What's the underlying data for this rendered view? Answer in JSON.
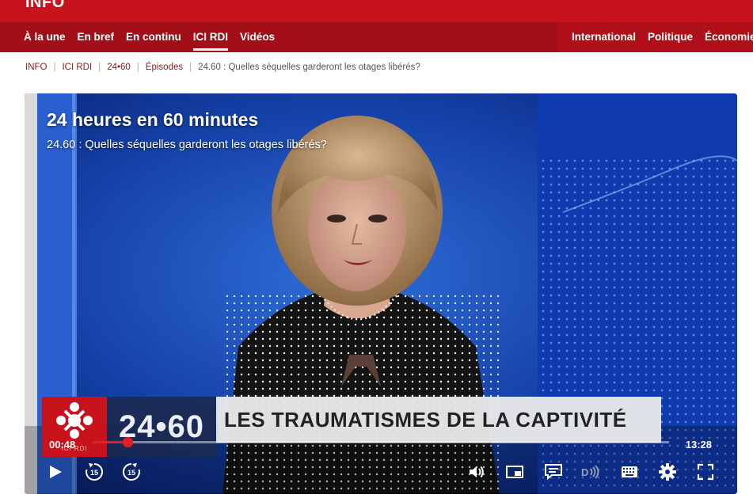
{
  "header": {
    "brand": "INFO",
    "nav_left": [
      "À la une",
      "En bref",
      "En continu",
      "ICI RDI",
      "Vidéos"
    ],
    "active_index": 3,
    "nav_right": [
      "International",
      "Politique",
      "Économie"
    ]
  },
  "breadcrumb": [
    "INFO",
    "ICI RDI",
    "24•60",
    "Épisodes",
    "24.60 : Quelles séquelles garderont les otages libérés?"
  ],
  "player": {
    "overlay_title": "24 heures en 60 minutes",
    "overlay_subtitle": "24.60 : Quelles séquelles garderont les otages libérés?",
    "lower_third": {
      "network": "ICI RDI",
      "show": "24•60",
      "headline": "LES TRAUMATISMES DE LA CAPTIVITÉ"
    },
    "current_time": "00:48",
    "total_time": "13:28",
    "progress": 0.06,
    "controls": {
      "play": "play-icon",
      "rewind_label": "15",
      "forward_label": "15",
      "volume": "volume-icon",
      "pip": "picture-in-picture-icon",
      "captions": "captions-icon",
      "audio_description": "audio-description-icon",
      "keyboard": "keyboard-icon",
      "settings": "gear-icon",
      "fullscreen": "fullscreen-icon"
    }
  },
  "colors": {
    "brand_red": "#c8121c",
    "nav_red": "#a30f18",
    "progress_red": "#e41e26"
  }
}
